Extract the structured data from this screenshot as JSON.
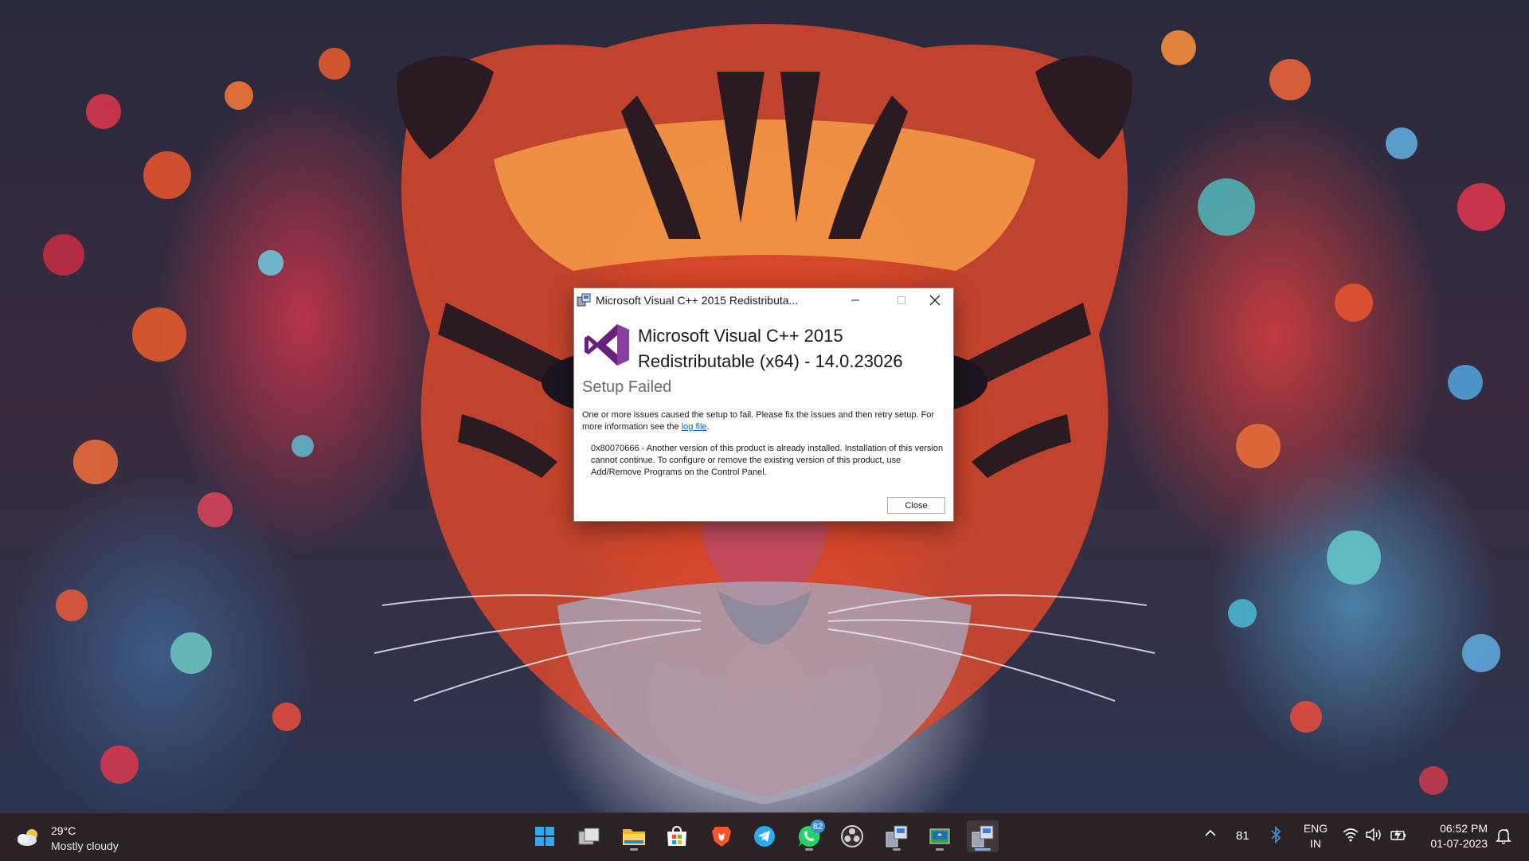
{
  "dialog": {
    "title": "Microsoft Visual C++ 2015 Redistributa...",
    "product_name": "Microsoft Visual C++ 2015 Redistributable (x64) - 14.0.23026",
    "status": "Setup Failed",
    "info_text": "One or more issues caused the setup to fail. Please fix the issues and then retry setup. For more information see the",
    "log_link": "log file",
    "info_suffix": ".",
    "error_text": "0x80070666 - Another version of this product is already installed. Installation of this version cannot continue. To configure or remove the existing version of this product, use Add/Remove Programs on the Control Panel.",
    "close_button": "Close",
    "accent_color": "#68217a"
  },
  "taskbar": {
    "weather": {
      "temperature": "29°C",
      "condition": "Mostly cloudy",
      "icon": "partly-cloudy-icon"
    },
    "apps": [
      {
        "name": "start-button",
        "icon": "windows-logo-icon"
      },
      {
        "name": "task-view",
        "icon": "task-view-icon"
      },
      {
        "name": "file-explorer",
        "icon": "folder-icon"
      },
      {
        "name": "microsoft-store",
        "icon": "store-icon"
      },
      {
        "name": "brave-browser",
        "icon": "brave-icon"
      },
      {
        "name": "telegram",
        "icon": "telegram-icon"
      },
      {
        "name": "whatsapp",
        "icon": "whatsapp-icon",
        "badge": "82"
      },
      {
        "name": "obs-studio",
        "icon": "obs-icon"
      },
      {
        "name": "installer-1",
        "icon": "installer-icon"
      },
      {
        "name": "installer-2",
        "icon": "installer-icon"
      },
      {
        "name": "installer-3",
        "icon": "installer-icon",
        "active": true
      }
    ],
    "tray": {
      "hidden_count": "81",
      "language_line1": "ENG",
      "language_line2": "IN",
      "time": "06:52 PM",
      "date": "01-07-2023"
    }
  }
}
